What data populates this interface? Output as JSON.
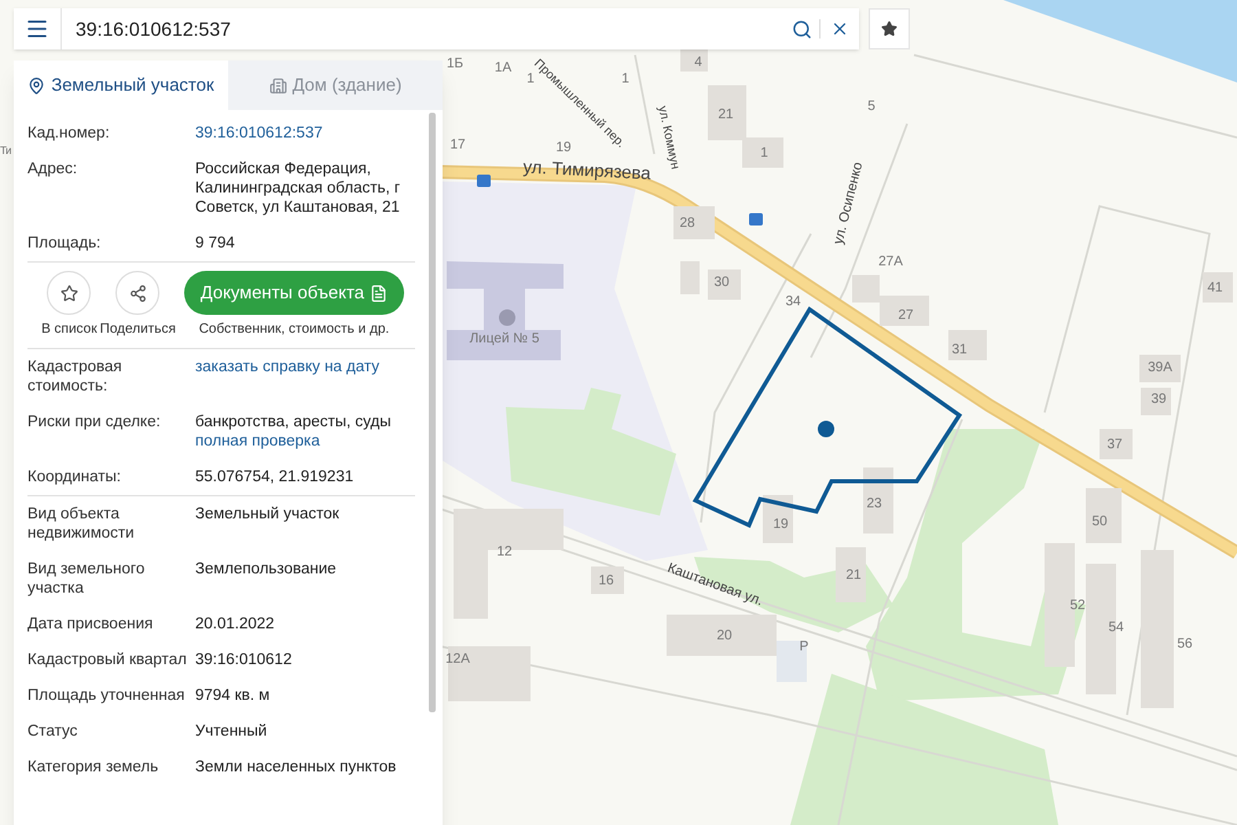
{
  "search": {
    "value": "39:16:010612:537"
  },
  "tabs": [
    {
      "label": "Земельный участок",
      "selected": true
    },
    {
      "label": "Дом (здание)",
      "selected": false
    }
  ],
  "groups": [
    {
      "rows": [
        {
          "label": "Кад.номер:",
          "link": "39:16:010612:537"
        },
        {
          "label": "Адрес:",
          "value": "Российская Федерация, Калининградская область, г Советск, ул Каштановая, 21"
        },
        {
          "label": "Площадь:",
          "value": "9 794"
        }
      ]
    },
    {
      "actions": [
        {
          "label": "В список"
        },
        {
          "label": "Поделиться"
        }
      ],
      "documents": {
        "label": "Документы объекта",
        "caption": "Собственник, стоимость и др."
      }
    },
    {
      "rows": [
        {
          "label": "Кадастровая стоимость:",
          "link": "заказать справку на дату"
        },
        {
          "label": "Риски при сделке:",
          "value": "банкротства, аресты, суды",
          "link": "полная проверка"
        },
        {
          "label": "Координаты:",
          "value": "55.076754, 21.919231"
        }
      ]
    },
    {
      "rows": [
        {
          "label": "Вид объекта недвижимости",
          "value": "Земельный участок"
        },
        {
          "label": "Вид земельного участка",
          "value": "Землепользование"
        },
        {
          "label": "Дата присвоения",
          "value": "20.01.2022"
        },
        {
          "label": "Кадастровый квартал",
          "value": "39:16:010612"
        },
        {
          "label": "Площадь уточненная",
          "value": "9794 кв. м"
        },
        {
          "label": "Статус",
          "value": "Учтенный"
        },
        {
          "label": "Категория земель",
          "value": "Земли населенных пунктов"
        }
      ]
    }
  ],
  "map": {
    "labels": [
      "Ти",
      "1Б",
      "1А",
      "1",
      "1",
      "4",
      "21",
      "5",
      "17",
      "19",
      "1",
      "28",
      "30",
      "34",
      "27А",
      "27",
      "31",
      "41",
      "39А",
      "39",
      "37",
      "50",
      "52",
      "54",
      "56",
      "23",
      "19",
      "21",
      "12",
      "16",
      "20",
      "12А",
      "P",
      "Лицей № 5"
    ],
    "streets": [
      "ул. Тимирязева",
      "Промышленный пер.",
      "ул. Коммун",
      "ул. Осипенко",
      "Каштановая ул."
    ]
  }
}
